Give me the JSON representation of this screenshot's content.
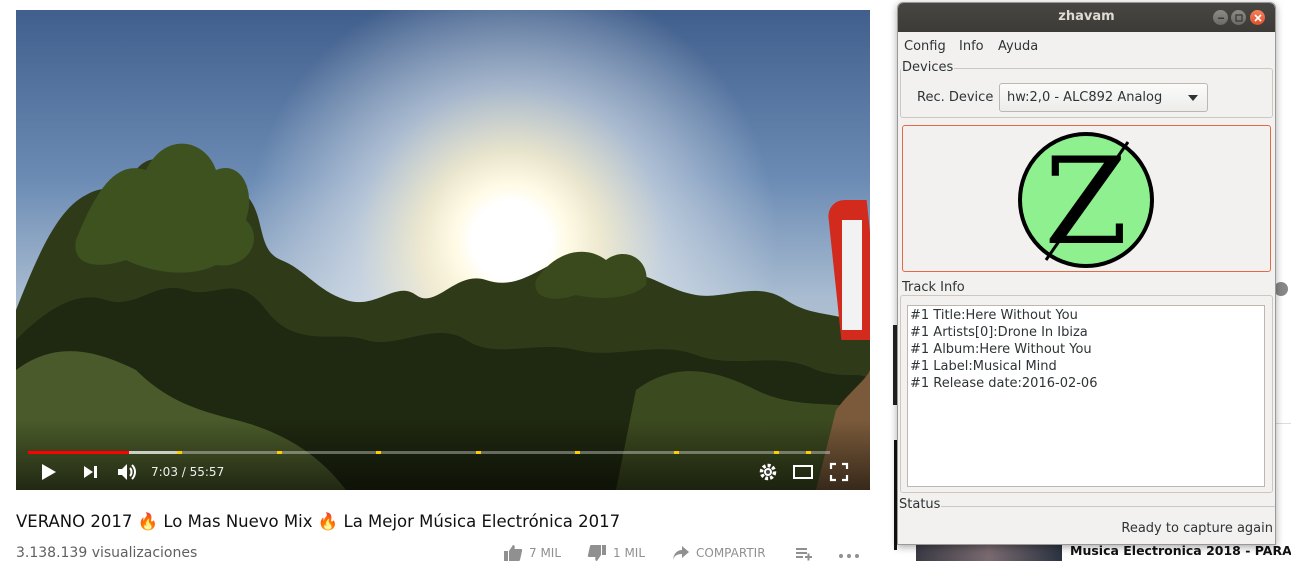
{
  "video": {
    "time_current": "7:03",
    "time_total": "55:57",
    "time_display": "7:03 / 55:57",
    "played_fraction": 0.126,
    "buffered_fraction": 0.186,
    "chapter_marks_fraction": [
      0.186,
      0.31,
      0.434,
      0.558,
      0.682,
      0.806,
      0.93,
      0.97
    ]
  },
  "page": {
    "title": "VERANO 2017 🔥 Lo Mas Nuevo Mix 🔥 La Mejor Música Electrónica 2017",
    "views": "3.138.139 visualizaciones",
    "likes": "7 MIL",
    "dislikes": "1 MIL",
    "share": "COMPARTIR"
  },
  "sidebar_peek": {
    "bottom_title": "Musica Electronica 2018 - PARA"
  },
  "window": {
    "title": "zhavam",
    "menu": [
      "Config",
      "Info",
      "Ayuda"
    ],
    "devices_label": "Devices",
    "rec_device_label": "Rec. Device",
    "rec_device_value": "hw:2,0 - ALC892 Analog",
    "logo_letter": "Z",
    "track_info_label": "Track Info",
    "track_lines": [
      "#1 Title:Here Without You",
      "#1 Artists[0]:Drone In Ibiza",
      "#1 Album:Here Without You",
      "#1 Label:Musical Mind",
      "#1 Release date:2016-02-06"
    ],
    "status_label": "Status",
    "status_text": "Ready to capture again"
  },
  "colors": {
    "progress_played": "#ff0000",
    "chapter_mark": "#ffcc00",
    "close_button": "#e0502a",
    "logo_green": "#8ef08e",
    "logo_frame": "#e36a46"
  }
}
